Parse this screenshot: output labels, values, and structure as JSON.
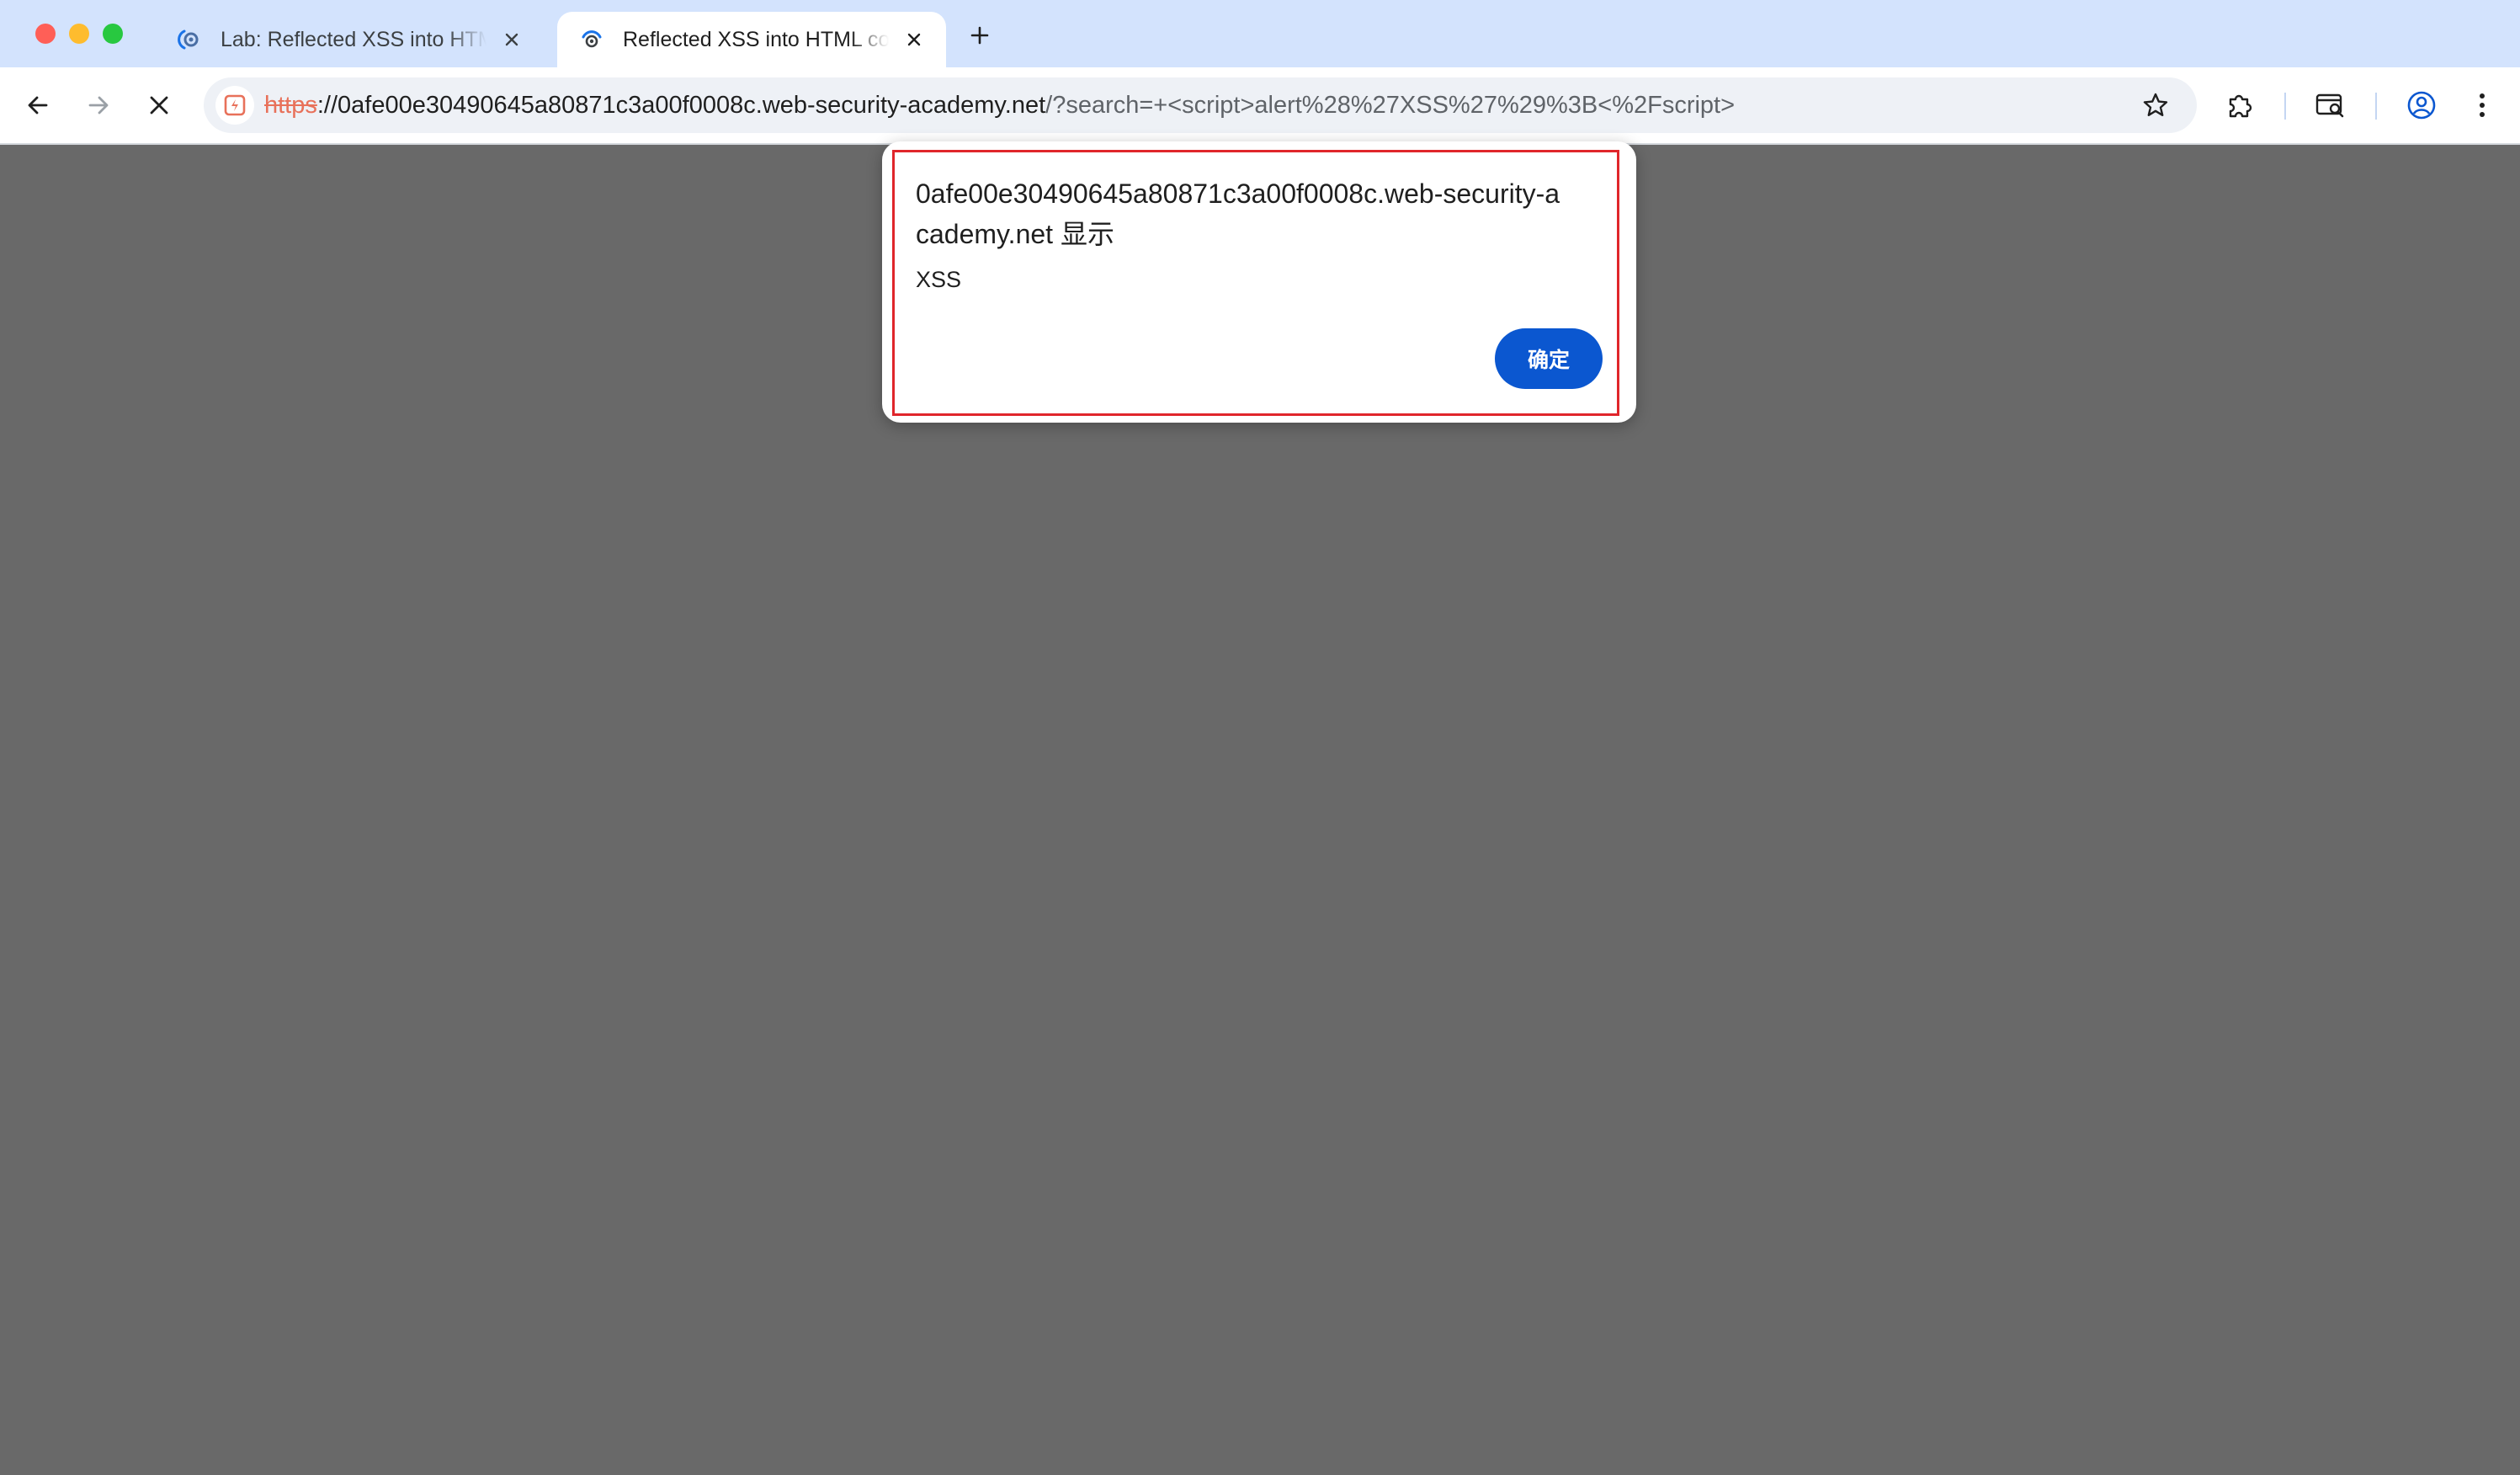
{
  "window": {
    "traffic_lights": [
      "close",
      "minimize",
      "maximize"
    ]
  },
  "tabs": [
    {
      "title": "Lab: Reflected XSS into HTML context with nothing encoded",
      "favicon": "portswigger-icon",
      "active": false
    },
    {
      "title": "Reflected XSS into HTML context with nothing encoded",
      "favicon": "loading-spinner-icon",
      "active": true
    }
  ],
  "new_tab_icon": "plus-icon",
  "toolbar": {
    "back_icon": "arrow-left-icon",
    "forward_icon": "arrow-right-icon",
    "stop_icon": "close-icon",
    "url": {
      "scheme": "https",
      "host": "://0afe00e30490645a80871c3a00f0008c.web-security-academy.net",
      "path": "/?search=+<script>alert%28%27XSS%27%29%3B<%2Fscript>"
    },
    "site_info_icon": "not-secure-icon",
    "bookmark_icon": "star-icon",
    "extensions_icon": "puzzle-icon",
    "tab_search_icon": "tab-search-icon",
    "profile_icon": "account-circle-icon",
    "menu_icon": "more-vertical-icon"
  },
  "dialog": {
    "title": "0afe00e30490645a80871c3a00f0008c.web-security-academy.net 显示",
    "message": "XSS",
    "ok_label": "确定"
  },
  "colors": {
    "tabstrip": "#d3e3fd",
    "content_background": "#696969",
    "url_scheme": "#e8715a",
    "dialog_button": "#0b57d0",
    "highlight_border": "#e0262b"
  }
}
